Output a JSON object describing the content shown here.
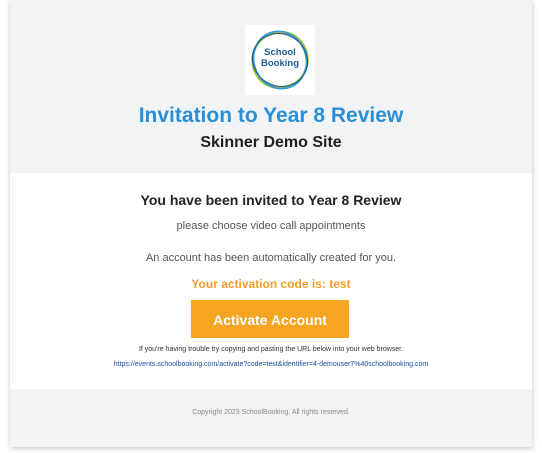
{
  "logo": {
    "line1": "School",
    "line2": "Booking"
  },
  "header": {
    "title": "Invitation to Year 8 Review",
    "site_name": "Skinner Demo Site"
  },
  "body": {
    "invited_heading": "You have been invited to Year 8 Review",
    "choose_text": "please choose video call appointments",
    "account_text": "An account has been automatically created for you.",
    "activation_code_text": "Your activation code is: test",
    "activate_button_label": "Activate Account",
    "trouble_text": "If you're having trouble try copying and pasting the URL below into your web browser.",
    "activation_url": "https://events.schoolbooking.com/activate?code=test&identifier=4-demouser7%40schoolbooking.com"
  },
  "footer": {
    "copyright": "Copyright 2023 SchoolBooking. All rights reserved."
  },
  "colors": {
    "title_blue": "#2a8fd6",
    "accent_orange": "#f6a523",
    "activation_orange": "#f29d2a",
    "link_blue": "#1a4fa0",
    "header_bg": "#f1f3f5"
  }
}
